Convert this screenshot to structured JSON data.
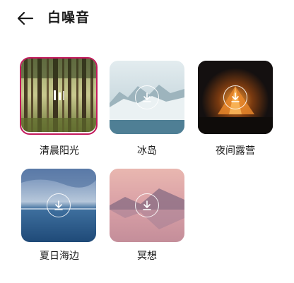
{
  "header": {
    "title": "白噪音",
    "back_icon": "arrow-left-icon"
  },
  "accent_color": "#c2185b",
  "sounds": [
    {
      "label": "清晨阳光",
      "state": "playing",
      "selected": true,
      "icon": "pause-icon"
    },
    {
      "label": "冰岛",
      "state": "not-downloaded",
      "selected": false,
      "icon": "download-icon"
    },
    {
      "label": "夜间露营",
      "state": "not-downloaded",
      "selected": false,
      "icon": "download-icon"
    },
    {
      "label": "夏日海边",
      "state": "not-downloaded",
      "selected": false,
      "icon": "download-icon"
    },
    {
      "label": "冥想",
      "state": "not-downloaded",
      "selected": false,
      "icon": "download-icon"
    }
  ]
}
